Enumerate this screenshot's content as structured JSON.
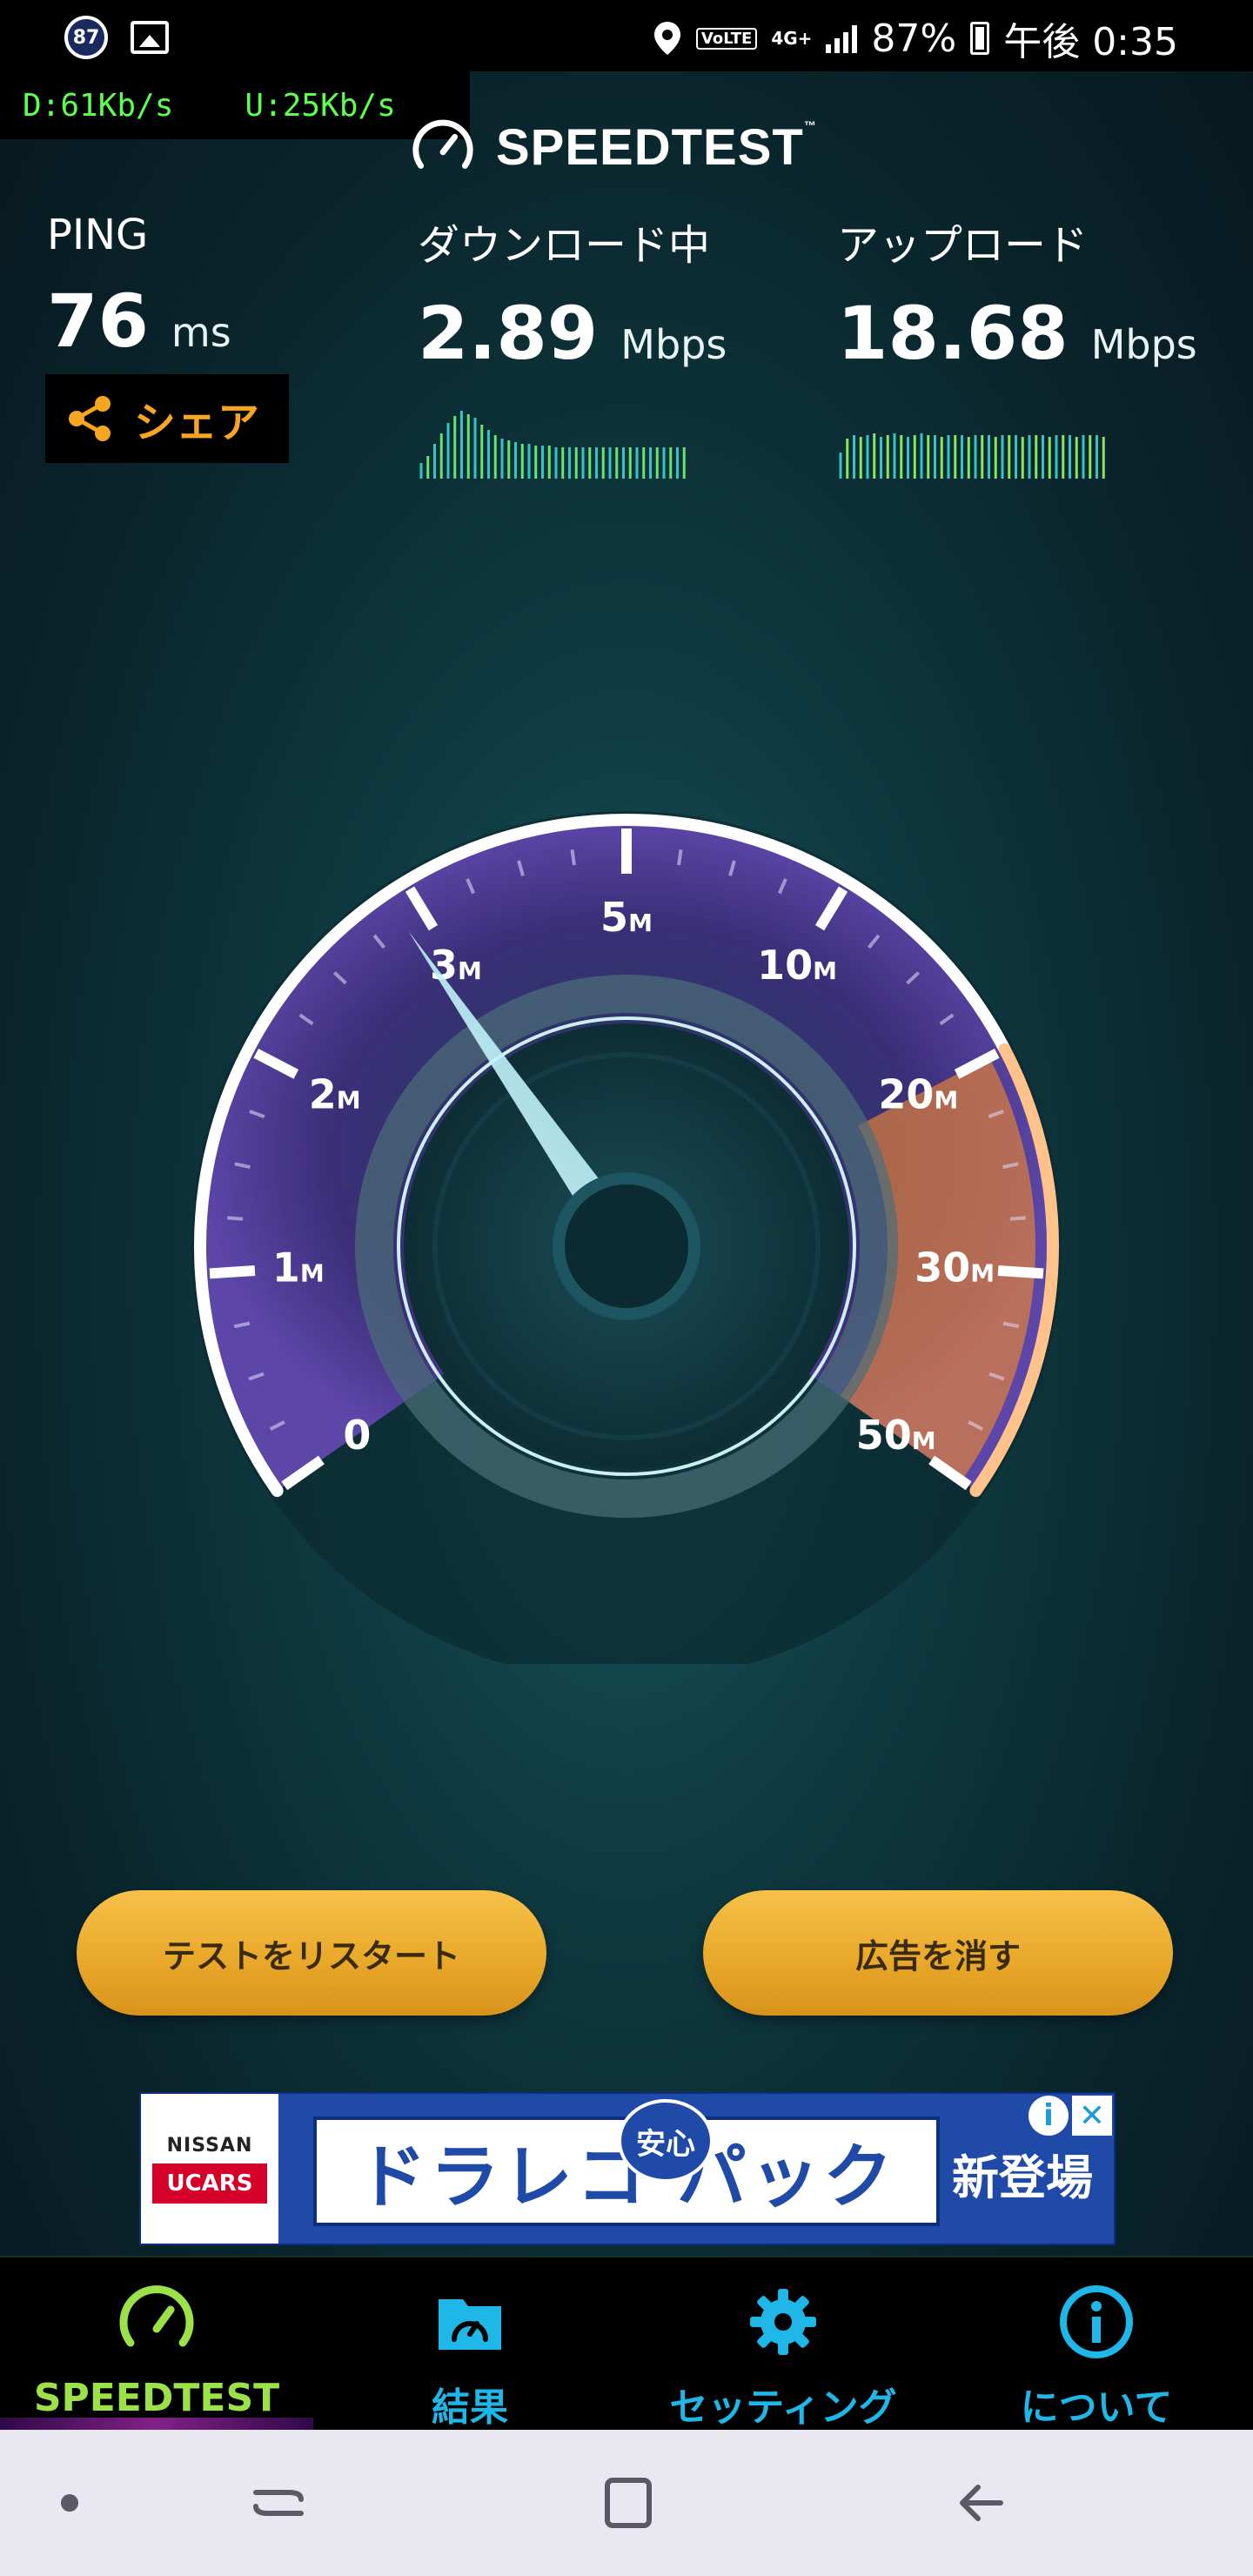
{
  "status_bar": {
    "notification_badge": "87",
    "volte": "VoLTE",
    "network": "4G+",
    "battery": "87%",
    "time": "午後 0:35"
  },
  "overlay": {
    "download": "D:61Kb/s",
    "upload": "U:25Kb/s"
  },
  "app": {
    "brand": "SPEEDTEST",
    "brand_tm": "™",
    "ping": {
      "label": "PING",
      "value": "76",
      "unit": "ms"
    },
    "download": {
      "label": "ダウンロード中",
      "value": "2.89",
      "unit": "Mbps"
    },
    "upload": {
      "label": "アップロード",
      "value": "18.68",
      "unit": "Mbps"
    },
    "share_label": "シェア",
    "gauge": {
      "ticks": [
        {
          "num": "0",
          "unit": ""
        },
        {
          "num": "1",
          "unit": "M"
        },
        {
          "num": "2",
          "unit": "M"
        },
        {
          "num": "3",
          "unit": "M"
        },
        {
          "num": "5",
          "unit": "M"
        },
        {
          "num": "10",
          "unit": "M"
        },
        {
          "num": "20",
          "unit": "M"
        },
        {
          "num": "30",
          "unit": "M"
        },
        {
          "num": "50",
          "unit": "M"
        }
      ],
      "current_mbps": 2.89
    },
    "restart_button": "テストをリスタート",
    "remove_ads_button": "広告を消す"
  },
  "ad": {
    "brand_top": "NISSAN",
    "brand_bottom": "UCARS",
    "headline": "ドラレコ パック",
    "badge": "安心",
    "tagline": "新登場",
    "info": "i",
    "close": "✕"
  },
  "bottom_nav": {
    "items": [
      {
        "label": "SPEEDTEST",
        "icon": "speedometer-icon",
        "active": true
      },
      {
        "label": "結果",
        "icon": "results-folder-icon",
        "active": false
      },
      {
        "label": "セッティング",
        "icon": "gear-icon",
        "active": false
      },
      {
        "label": "について",
        "icon": "info-icon",
        "active": false
      }
    ]
  },
  "colors": {
    "accent_green": "#9ce14a",
    "accent_blue": "#1fb6e8",
    "share_orange": "#f6a623",
    "overlay_green": "#5dff4f",
    "gauge_purple": "#8e6ad8",
    "gauge_orange": "#f0883a"
  }
}
